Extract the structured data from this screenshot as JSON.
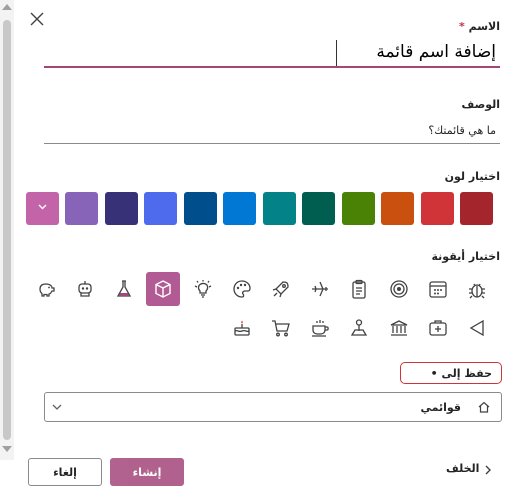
{
  "form": {
    "name_label": "الاسم",
    "required_mark": "*",
    "name_value": "إضافة اسم قائمة",
    "description_label": "الوصف",
    "description_value": "ما هي قائمتك؟",
    "color_label": "اختيار لون",
    "icon_label": "اختيار أيقونة",
    "save_to_label": "حفظ إلى •",
    "save_to_value": "قوائمي"
  },
  "colors": [
    "#a4262c",
    "#d13438",
    "#ca5010",
    "#498205",
    "#005e50",
    "#038387",
    "#0078d4",
    "#004e8c",
    "#4f6bed",
    "#373277",
    "#8764b8",
    "#c363a8"
  ],
  "selected_color": "#c363a8",
  "icons_row1": [
    "bug-icon",
    "calendar-icon",
    "target-icon",
    "clipboard-icon",
    "airplane-icon",
    "rocket-icon",
    "palette-icon",
    "lightbulb-icon",
    "cube-icon",
    "flask-icon",
    "robot-icon",
    "piggy-bank-icon"
  ],
  "icons_row2": [
    "triangle-left-icon",
    "medical-kit-icon",
    "bank-icon",
    "map-pin-icon",
    "coffee-icon",
    "cart-icon",
    "cake-icon"
  ],
  "selected_icon": "cube-icon",
  "footer": {
    "cancel_label": "إلغاء",
    "create_label": "إنشاء",
    "back_label": "الخلف"
  }
}
